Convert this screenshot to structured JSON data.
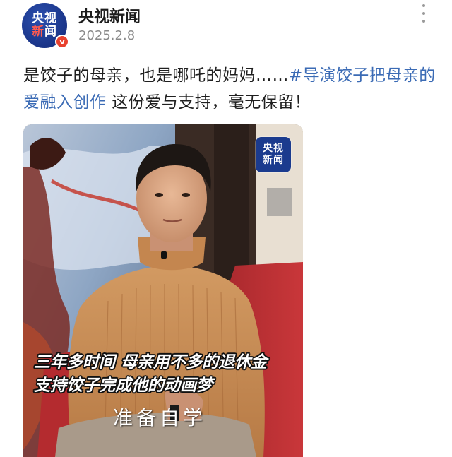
{
  "account": {
    "avatar_line1": "央视",
    "avatar_line2_red": "新",
    "avatar_line2_white": "闻",
    "verified_badge": "v",
    "name": "央视新闻",
    "date": "2025.2.8"
  },
  "menu": {
    "icon": "more-vertical-icon"
  },
  "post": {
    "text_plain": "是饺子的母亲，也是哪吒的妈妈……",
    "hashtag": "#导演饺子把母亲的爱融入创作",
    "text_tail": " 这份爱与支持，毫无保留！"
  },
  "video": {
    "watermark_line1": "央视",
    "watermark_line2": "新闻",
    "subtitle_line1": "三年多时间 母亲用不多的退休金",
    "subtitle_line2": "支持饺子完成他的动画梦",
    "caption": "准备自学"
  },
  "colors": {
    "hashtag": "#3b6bb5",
    "verified": "#e8412e",
    "brand_blue": "#1b3b8e"
  }
}
